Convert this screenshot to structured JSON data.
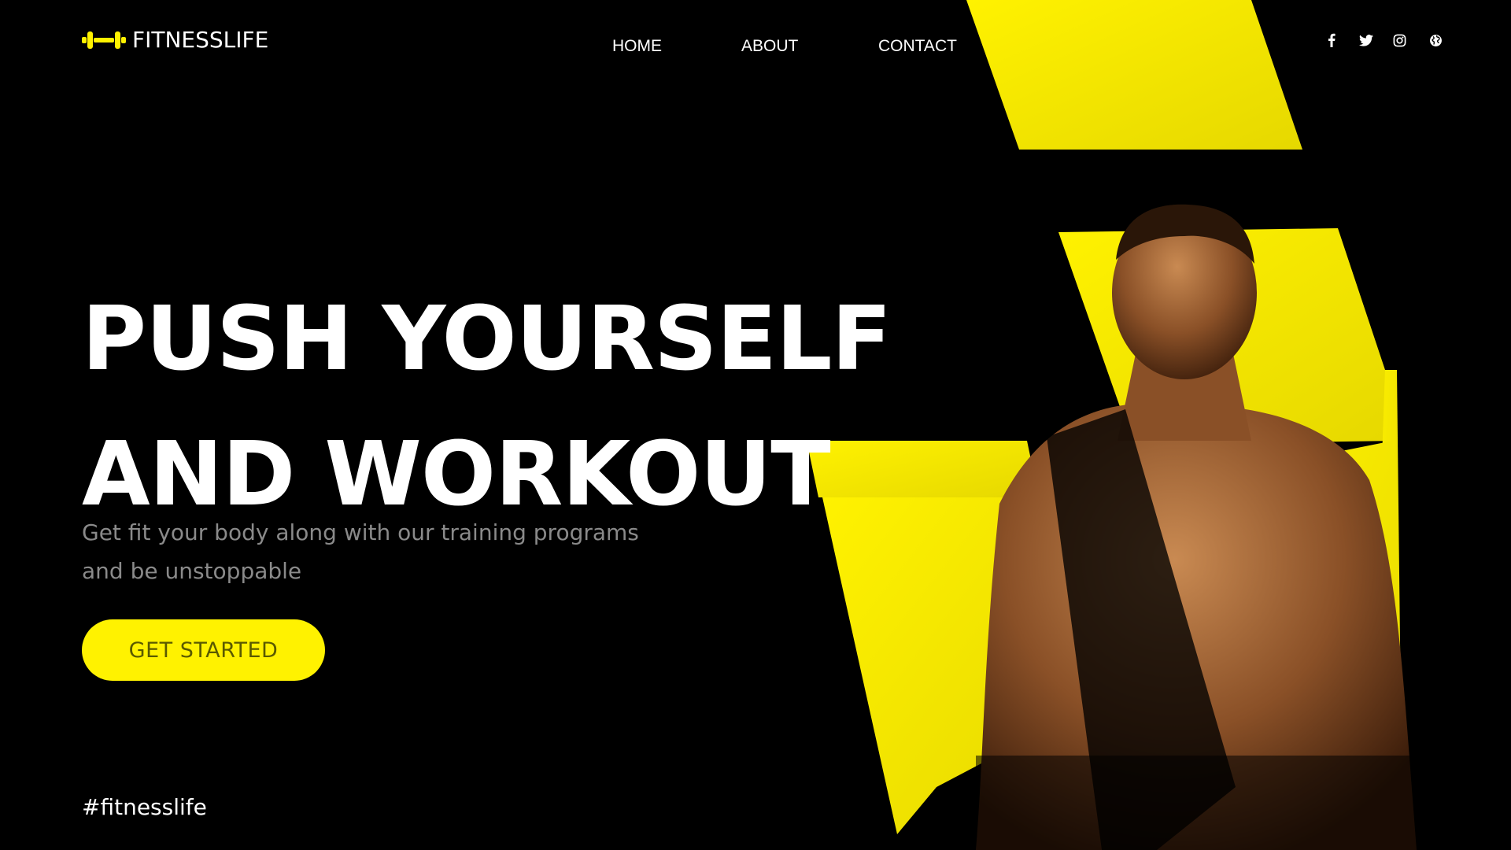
{
  "brand": {
    "name": "FITNESSLIFE",
    "logo_icon": "dumbbell-icon",
    "accent_color": "#FFF200"
  },
  "nav": {
    "items": [
      {
        "label": "HOME"
      },
      {
        "label": "ABOUT"
      },
      {
        "label": "CONTACT"
      }
    ]
  },
  "social": {
    "icons": [
      "facebook-icon",
      "twitter-icon",
      "instagram-icon",
      "globe-icon"
    ]
  },
  "hero": {
    "headline_line1": "PUSH YOURSELF",
    "headline_line2": "AND WORKOUT",
    "subtitle_line1": "Get fit your body along with our training programs",
    "subtitle_line2": "and be unstoppable",
    "cta_label": "GET STARTED",
    "hashtag": "#fitnesslife"
  },
  "colors": {
    "background": "#000000",
    "text": "#FFFFFF",
    "subtitle": "#8A8A8A",
    "cta_background": "#FFF200",
    "cta_text": "#5A5A00"
  }
}
